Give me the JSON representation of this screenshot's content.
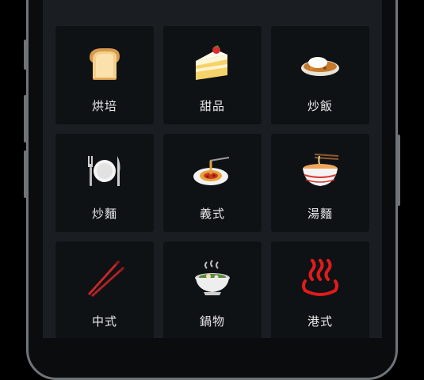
{
  "menu": {
    "items": [
      {
        "label": "烘培",
        "icon": "bread-icon"
      },
      {
        "label": "甜品",
        "icon": "cake-icon"
      },
      {
        "label": "炒飯",
        "icon": "curry-rice-icon"
      },
      {
        "label": "炒麵",
        "icon": "plate-fork-knife-icon"
      },
      {
        "label": "義式",
        "icon": "spaghetti-icon"
      },
      {
        "label": "湯麵",
        "icon": "noodle-soup-icon"
      },
      {
        "label": "中式",
        "icon": "chopsticks-icon"
      },
      {
        "label": "鍋物",
        "icon": "hot-pot-icon"
      },
      {
        "label": "港式",
        "icon": "hot-springs-icon"
      }
    ]
  },
  "colors": {
    "screen_bg": "#1a1e23",
    "tile_bg": "#0f1215",
    "label_text": "#e8e8e8",
    "frame": "#6f7478"
  }
}
